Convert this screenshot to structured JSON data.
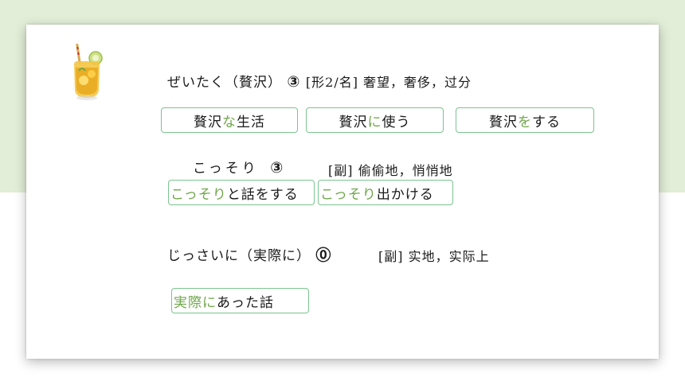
{
  "colors": {
    "background_band": "#e2eed8",
    "box_border": "#7cc48f",
    "highlight_green": "#6fa64a"
  },
  "icon": "iced-lemon-drink-icon",
  "entries": [
    {
      "reading": "ぜいたく（贅沢）",
      "accent": "③",
      "def": "[形2/名] 奢望，奢侈，过分",
      "examples": [
        {
          "a": "贅沢",
          "g": "な",
          "b": "生活"
        },
        {
          "a": "贅沢",
          "g": "に",
          "b": "使う"
        },
        {
          "a": "贅沢",
          "g": "を",
          "b": "する"
        }
      ]
    },
    {
      "reading": "こっそり",
      "accent": "③",
      "def": "[副] 偷偷地，悄悄地",
      "examples": [
        {
          "g": "こっそり",
          "b": "と話をする"
        },
        {
          "g": "こっそり",
          "b": "出かける"
        }
      ]
    },
    {
      "reading": "じっさいに（実際に）",
      "accent": "⓪",
      "def": "[副] 实地，实际上",
      "examples": [
        {
          "g": "実際に",
          "b": "あった話"
        }
      ]
    }
  ]
}
